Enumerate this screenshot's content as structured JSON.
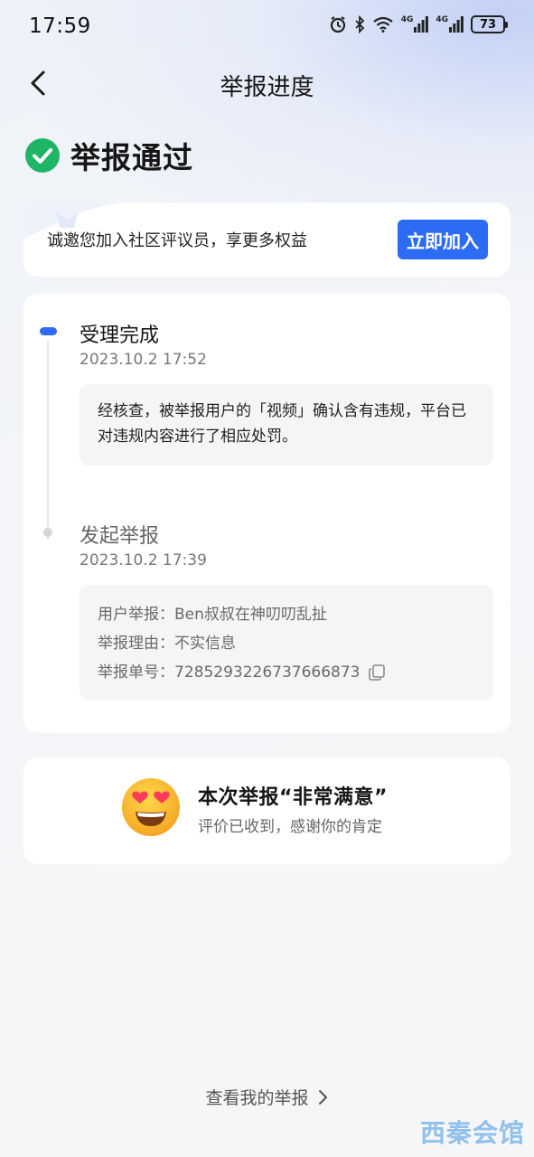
{
  "status_bar": {
    "time": "17:59",
    "network_1": "4G",
    "network_2": "4G",
    "battery": "73"
  },
  "nav": {
    "title": "举报进度"
  },
  "result": {
    "text": "举报通过",
    "color": "#1fb566"
  },
  "invite": {
    "text": "诚邀您加入社区评议员，享更多权益",
    "button": "立即加入",
    "accent": "#2c6cf5"
  },
  "timeline": {
    "steps": [
      {
        "title": "受理完成",
        "time": "2023.10.2 17:52",
        "detail": "经核查，被举报用户的「视频」确认含有违规，平台已对违规内容进行了相应处罚。"
      },
      {
        "title": "发起举报",
        "time": "2023.10.2 17:39",
        "fields": [
          {
            "label": "用户举报：",
            "value": "Ben叔叔在神叨叨乱扯"
          },
          {
            "label": "举报理由：",
            "value": "不实信息"
          },
          {
            "label": "举报单号：",
            "value": "7285293226737666873"
          }
        ]
      }
    ]
  },
  "satisfaction": {
    "title": "本次举报“非常满意”",
    "subtitle": "评价已收到，感谢你的肯定"
  },
  "footer": {
    "link": "查看我的举报",
    "watermark": "西秦会馆"
  }
}
